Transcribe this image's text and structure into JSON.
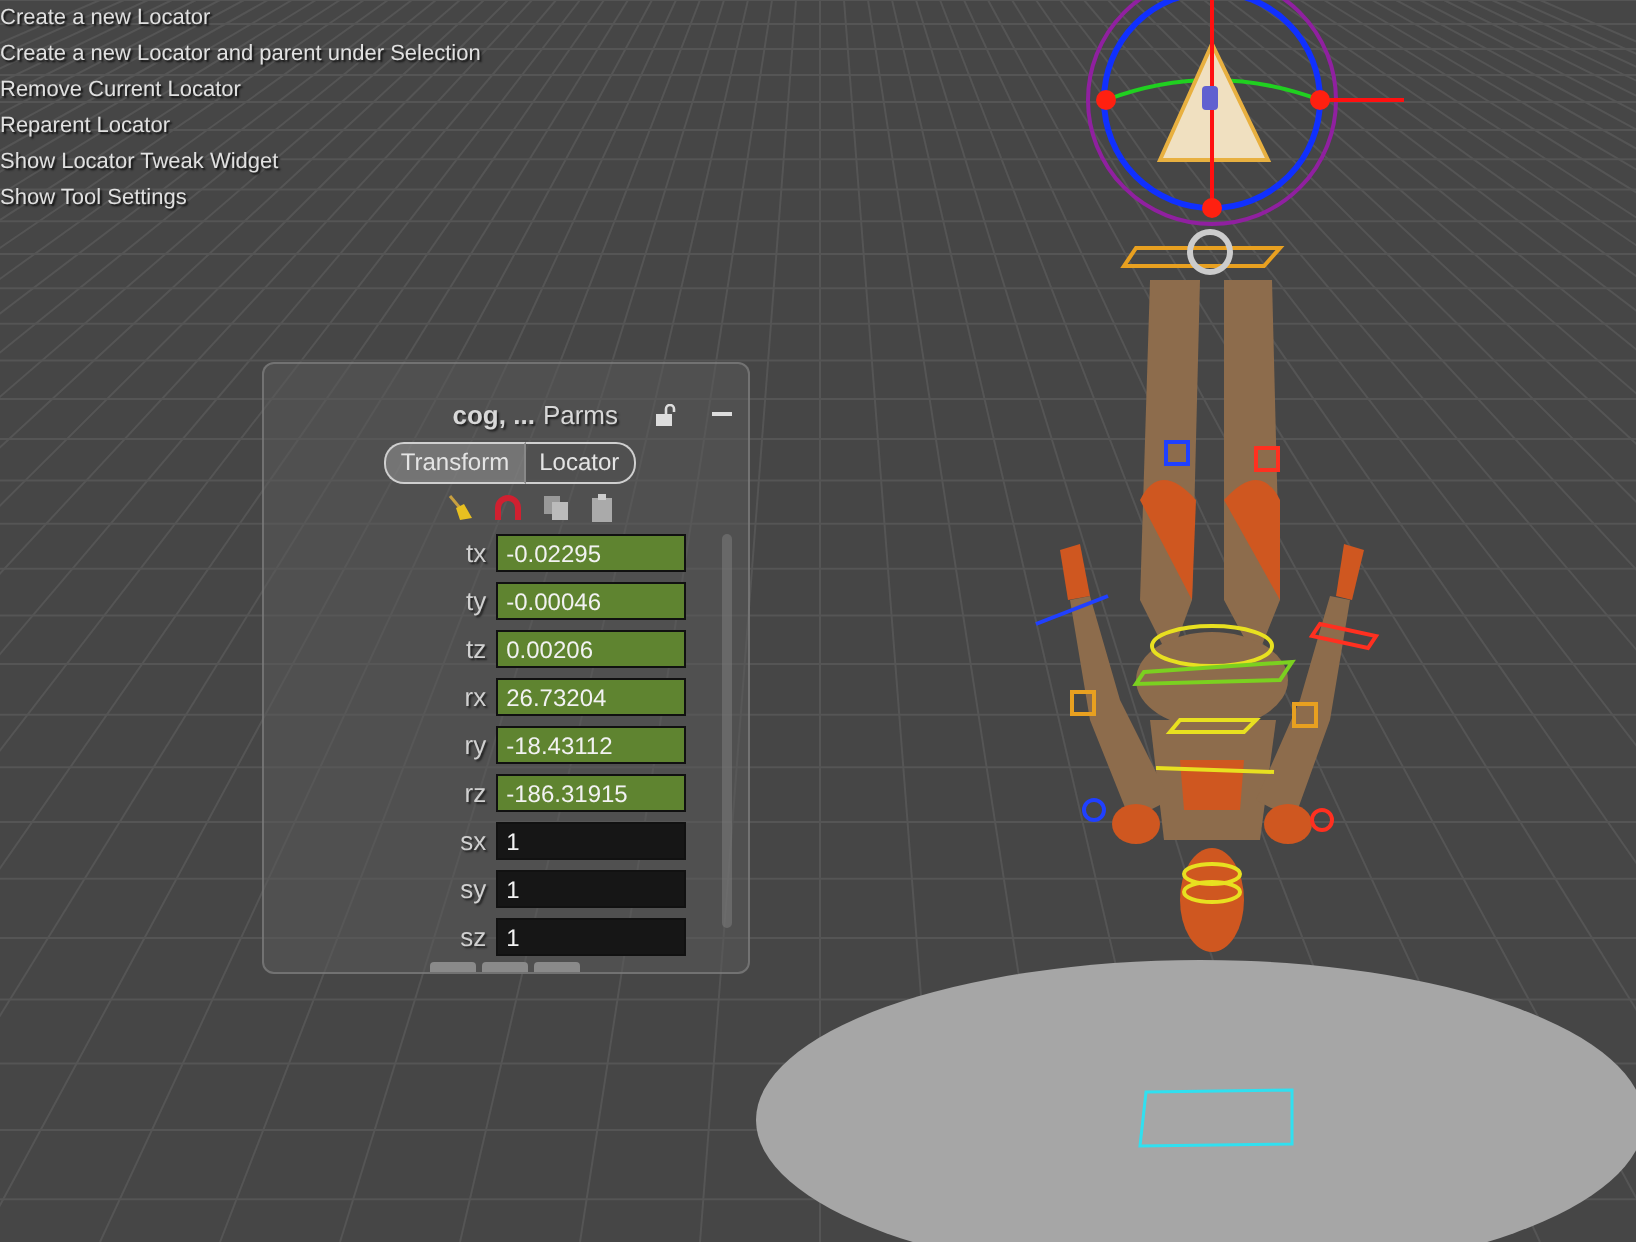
{
  "menu": {
    "items": [
      {
        "label": "Create a new Locator"
      },
      {
        "label": "Create a new Locator and parent under Selection"
      },
      {
        "label": "Remove Current Locator"
      },
      {
        "label": "Reparent Locator"
      },
      {
        "label": "Show Locator Tweak Widget"
      },
      {
        "label": "Show Tool Settings"
      }
    ]
  },
  "panel": {
    "node": "cog, ...",
    "title": "Parms",
    "locked": false,
    "tabs": [
      {
        "label": "Transform",
        "selected": true
      },
      {
        "label": "Locator",
        "selected": false
      }
    ],
    "params": [
      {
        "name": "tx",
        "value": "-0.02295",
        "kind": "keyed"
      },
      {
        "name": "ty",
        "value": "-0.00046",
        "kind": "keyed"
      },
      {
        "name": "tz",
        "value": "0.00206",
        "kind": "keyed"
      },
      {
        "name": "rx",
        "value": "26.73204",
        "kind": "keyed"
      },
      {
        "name": "ry",
        "value": "-18.43112",
        "kind": "keyed"
      },
      {
        "name": "rz",
        "value": "-186.31915",
        "kind": "keyed"
      },
      {
        "name": "sx",
        "value": "1",
        "kind": "plain"
      },
      {
        "name": "sy",
        "value": "1",
        "kind": "plain"
      },
      {
        "name": "sz",
        "value": "1",
        "kind": "plain"
      }
    ]
  }
}
